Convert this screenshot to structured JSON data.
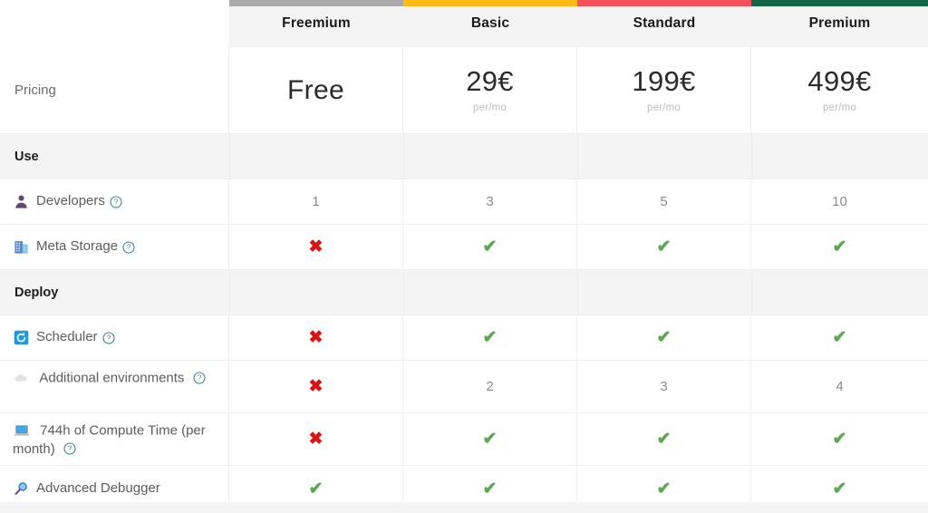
{
  "table": {
    "label_column_header": "",
    "plans": [
      {
        "name": "Freemium",
        "accent": "#a9a9a9",
        "price": "Free",
        "price_unit": ""
      },
      {
        "name": "Basic",
        "accent": "#fcb813",
        "price": "29€",
        "price_unit": "per/mo"
      },
      {
        "name": "Standard",
        "accent": "#f4505a",
        "price": "199€",
        "price_unit": "per/mo"
      },
      {
        "name": "Premium",
        "accent": "#166447",
        "price": "499€",
        "price_unit": "per/mo"
      }
    ],
    "pricing_row_label": "Pricing",
    "sections": [
      {
        "title": "Use",
        "features": [
          {
            "label": "Developers",
            "icon": "person-icon",
            "help": true,
            "values": [
              "1",
              "3",
              "5",
              "10"
            ],
            "value_types": [
              "text",
              "text",
              "text",
              "text"
            ]
          },
          {
            "label": "Meta Storage",
            "icon": "office-building-icon",
            "help": true,
            "values": [
              "✖",
              "✔",
              "✔",
              "✔"
            ],
            "value_types": [
              "no",
              "yes",
              "yes",
              "yes"
            ]
          }
        ]
      },
      {
        "title": "Deploy",
        "features": [
          {
            "label": "Scheduler",
            "icon": "scheduler-refresh-icon",
            "help": true,
            "values": [
              "✖",
              "✔",
              "✔",
              "✔"
            ],
            "value_types": [
              "no",
              "yes",
              "yes",
              "yes"
            ]
          },
          {
            "label": "Additional environments",
            "icon": "cloud-icon",
            "help": true,
            "values": [
              "✖",
              "2",
              "3",
              "4"
            ],
            "value_types": [
              "no",
              "text",
              "text",
              "text"
            ]
          },
          {
            "label": "744h of Compute Time (per month)",
            "icon": "laptop-icon",
            "help": true,
            "values": [
              "✖",
              "✔",
              "✔",
              "✔"
            ],
            "value_types": [
              "no",
              "yes",
              "yes",
              "yes"
            ]
          },
          {
            "label": "Advanced Debugger",
            "icon": "magnifier-icon",
            "help": false,
            "values": [
              "✔",
              "✔",
              "✔",
              "✔"
            ],
            "value_types": [
              "yes",
              "yes",
              "yes",
              "yes"
            ]
          }
        ]
      }
    ],
    "colors": {
      "check": "#5aa84f",
      "cross": "#d81414",
      "help_icon": "#3d8597",
      "section_band": "#f4f4f4",
      "header_cell": "#f4f4f4"
    }
  }
}
